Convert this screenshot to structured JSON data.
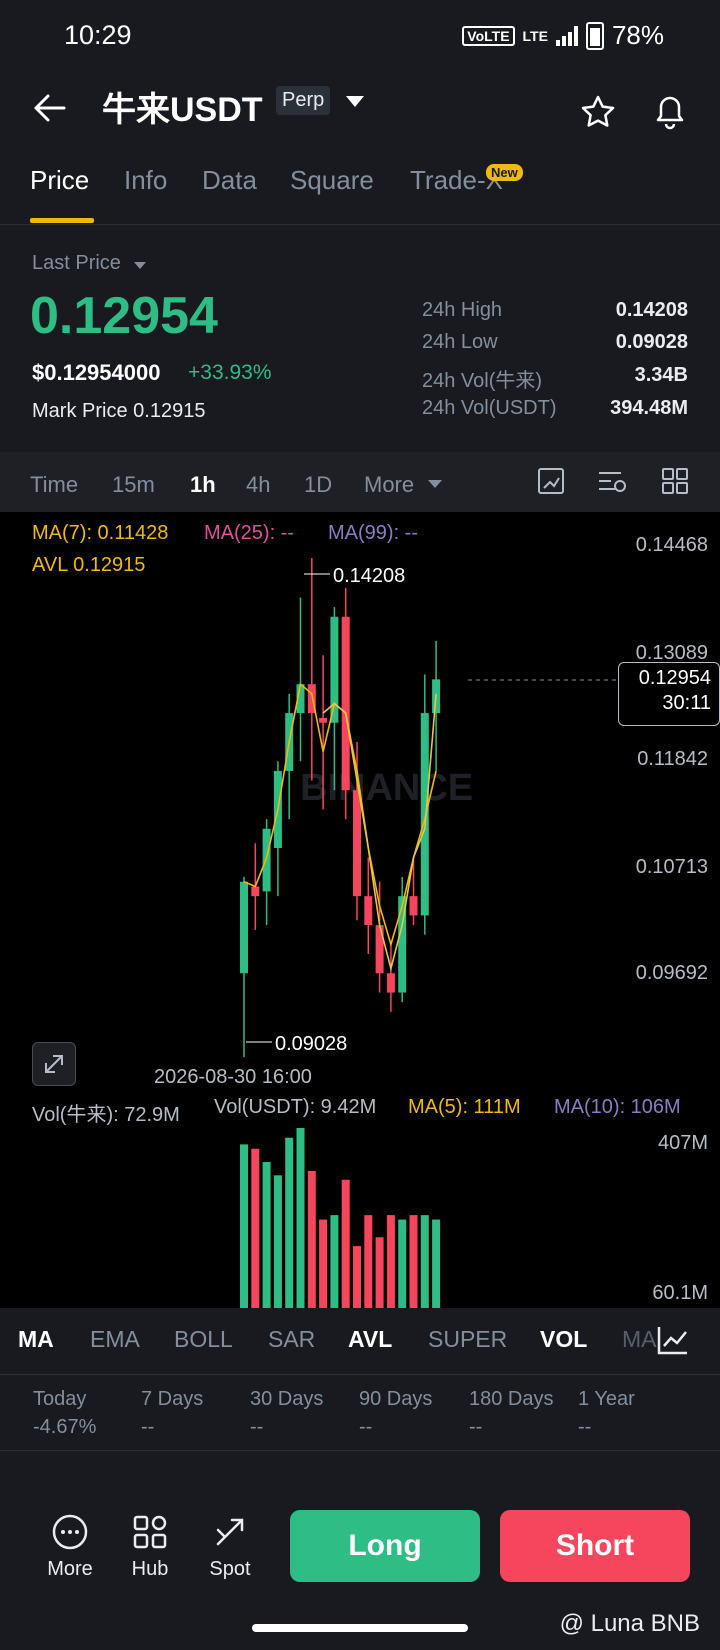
{
  "status_bar": {
    "time": "10:29",
    "volte": "VoLTE",
    "network": "LTE",
    "battery": "78%"
  },
  "header": {
    "pair": "牛来USDT",
    "badge": "Perp"
  },
  "tabs": [
    {
      "label": "Price",
      "active": true
    },
    {
      "label": "Info"
    },
    {
      "label": "Data"
    },
    {
      "label": "Square"
    },
    {
      "label": "Trade-X",
      "badge": "New"
    }
  ],
  "price": {
    "last_label": "Last Price",
    "last": "0.12954",
    "usd": "$0.12954000",
    "change": "+33.93%",
    "mark_label": "Mark Price",
    "mark_value": "0.12915"
  },
  "stats": [
    {
      "label": "24h High",
      "value": "0.14208"
    },
    {
      "label": "24h Low",
      "value": "0.09028"
    },
    {
      "label": "24h Vol(牛来)",
      "value": "3.34B"
    },
    {
      "label": "24h Vol(USDT)",
      "value": "394.48M"
    }
  ],
  "intervals": [
    "Time",
    "15m",
    "1h",
    "4h",
    "1D",
    "More"
  ],
  "active_interval": "1h",
  "chart_overlay": {
    "ma7": "MA(7): 0.11428",
    "ma25": "MA(25): --",
    "ma99": "MA(99): --",
    "avl": "AVL 0.12915",
    "high_marker": "0.14208",
    "low_marker": "0.09028",
    "price_axis": [
      "0.14468",
      "0.13089",
      "0.11842",
      "0.10713",
      "0.09692"
    ],
    "current_price": "0.12954",
    "countdown": "30:11",
    "time_label": "2026-08-30 16:00",
    "watermark": "BINANCE",
    "vol_coin": "Vol(牛来): 72.9M",
    "vol_usdt": "Vol(USDT): 9.42M",
    "vol_ma5": "MA(5): 111M",
    "vol_ma10": "MA(10): 106M",
    "vol_axis_top": "407M",
    "vol_axis_bottom": "60.1M"
  },
  "colors": {
    "up": "#2EBD85",
    "down": "#F6465D",
    "accent": "#F0B90B",
    "ma25": "#E0509E",
    "ma99": "#8E7CC3"
  },
  "chart_data": {
    "type": "candlestick",
    "candles": [
      {
        "o": 0.099,
        "h": 0.109,
        "l": 0.0903,
        "c": 0.1085,
        "up": true
      },
      {
        "o": 0.108,
        "h": 0.1125,
        "l": 0.1035,
        "c": 0.107,
        "up": false
      },
      {
        "o": 0.1075,
        "h": 0.115,
        "l": 0.104,
        "c": 0.114,
        "up": true
      },
      {
        "o": 0.112,
        "h": 0.121,
        "l": 0.107,
        "c": 0.12,
        "up": true
      },
      {
        "o": 0.12,
        "h": 0.128,
        "l": 0.115,
        "c": 0.126,
        "up": true
      },
      {
        "o": 0.126,
        "h": 0.138,
        "l": 0.121,
        "c": 0.129,
        "up": true
      },
      {
        "o": 0.129,
        "h": 0.1421,
        "l": 0.119,
        "c": 0.126,
        "up": false
      },
      {
        "o": 0.1255,
        "h": 0.132,
        "l": 0.116,
        "c": 0.125,
        "up": false
      },
      {
        "o": 0.125,
        "h": 0.137,
        "l": 0.118,
        "c": 0.136,
        "up": true
      },
      {
        "o": 0.136,
        "h": 0.139,
        "l": 0.115,
        "c": 0.118,
        "up": false
      },
      {
        "o": 0.118,
        "h": 0.123,
        "l": 0.1045,
        "c": 0.107,
        "up": false
      },
      {
        "o": 0.107,
        "h": 0.111,
        "l": 0.101,
        "c": 0.104,
        "up": false
      },
      {
        "o": 0.104,
        "h": 0.1085,
        "l": 0.097,
        "c": 0.099,
        "up": false
      },
      {
        "o": 0.099,
        "h": 0.102,
        "l": 0.095,
        "c": 0.097,
        "up": false
      },
      {
        "o": 0.097,
        "h": 0.109,
        "l": 0.096,
        "c": 0.107,
        "up": true
      },
      {
        "o": 0.107,
        "h": 0.111,
        "l": 0.104,
        "c": 0.105,
        "up": false
      },
      {
        "o": 0.105,
        "h": 0.13,
        "l": 0.103,
        "c": 0.126,
        "up": true
      },
      {
        "o": 0.126,
        "h": 0.1335,
        "l": 0.12,
        "c": 0.1295,
        "up": true
      }
    ],
    "volume": [
      370,
      360,
      330,
      300,
      385,
      407,
      310,
      200,
      210,
      290,
      140,
      210,
      160,
      210,
      200,
      210,
      210,
      200
    ],
    "ma7_line": [
      0.1085,
      0.108,
      0.111,
      0.116,
      0.123,
      0.129,
      0.128,
      0.122,
      0.127,
      0.126,
      0.12,
      0.112,
      0.106,
      0.102,
      0.106,
      0.111,
      0.115,
      0.12
    ],
    "avl_line": [
      null,
      null,
      null,
      null,
      null,
      null,
      null,
      0.126,
      0.127,
      0.126,
      0.119,
      0.112,
      0.104,
      0.0995,
      0.104,
      0.111,
      0.114,
      0.128
    ],
    "price_range": [
      0.09,
      0.145
    ],
    "volume_range": [
      0,
      407
    ]
  },
  "indicator_tabs": [
    {
      "label": "MA",
      "active": true
    },
    {
      "label": "EMA"
    },
    {
      "label": "BOLL"
    },
    {
      "label": "SAR"
    },
    {
      "label": "AVL",
      "active": true
    },
    {
      "label": "SUPER"
    },
    {
      "label": "VOL",
      "active": true
    },
    {
      "label": "MA"
    }
  ],
  "periods": [
    {
      "label": "Today",
      "value": "-4.67%"
    },
    {
      "label": "7 Days",
      "value": "--"
    },
    {
      "label": "30 Days",
      "value": "--"
    },
    {
      "label": "90 Days",
      "value": "--"
    },
    {
      "label": "180 Days",
      "value": "--"
    },
    {
      "label": "1 Year",
      "value": "--"
    }
  ],
  "bottom_nav": [
    {
      "label": "More",
      "icon": "more-circle-icon"
    },
    {
      "label": "Hub",
      "icon": "grid-hub-icon"
    },
    {
      "label": "Spot",
      "icon": "spot-arrows-icon"
    }
  ],
  "actions": {
    "long": "Long",
    "short": "Short"
  },
  "watermark_credit": "@ Luna BNB"
}
